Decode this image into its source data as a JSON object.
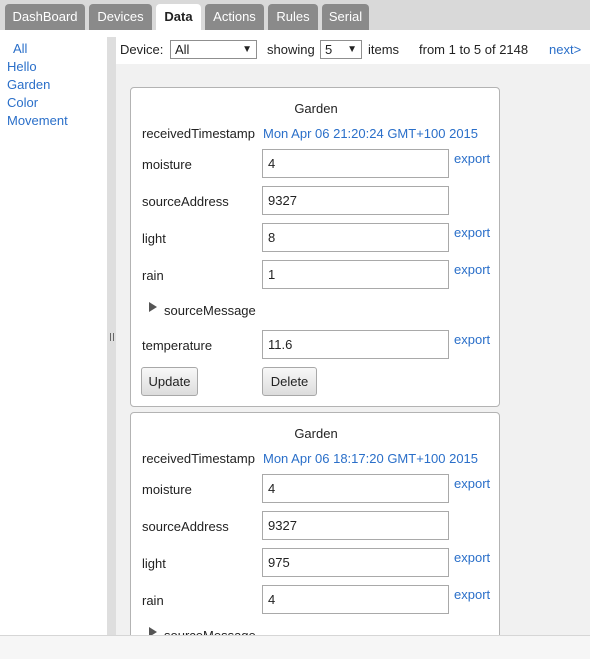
{
  "tabs": [
    {
      "label": "DashBoard"
    },
    {
      "label": "Devices"
    },
    {
      "label": "Data",
      "active": true
    },
    {
      "label": "Actions"
    },
    {
      "label": "Rules"
    },
    {
      "label": "Serial"
    }
  ],
  "sidebar": {
    "items": [
      {
        "label": "All"
      },
      {
        "label": "Hello"
      },
      {
        "label": "Garden"
      },
      {
        "label": "Color"
      },
      {
        "label": "Movement"
      }
    ]
  },
  "toolbar": {
    "device_label": "Device:",
    "device_value": "All",
    "showing_label": "showing",
    "count_value": "5",
    "items_label": "items",
    "range_text": "from 1 to 5 of 2148",
    "next_label": "next>"
  },
  "cards": [
    {
      "title": "Garden",
      "received_label": "receivedTimestamp",
      "received_value": "Mon Apr 06 21:20:24 GMT+100 2015",
      "moisture_label": "moisture",
      "moisture_value": "4",
      "source_label": "sourceAddress",
      "source_value": "9327",
      "light_label": "light",
      "light_value": "8",
      "rain_label": "rain",
      "rain_value": "1",
      "message_label": "sourceMessage",
      "temperature_label": "temperature",
      "temperature_value": "11.6",
      "export_label": "export",
      "update_label": "Update",
      "delete_label": "Delete"
    },
    {
      "title": "Garden",
      "received_label": "receivedTimestamp",
      "received_value": "Mon Apr 06 18:17:20 GMT+100 2015",
      "moisture_label": "moisture",
      "moisture_value": "4",
      "source_label": "sourceAddress",
      "source_value": "9327",
      "light_label": "light",
      "light_value": "975",
      "rain_label": "rain",
      "rain_value": "4",
      "message_label": "sourceMessage",
      "export_label": "export"
    }
  ],
  "colors": {
    "link": "#2a6fc9",
    "tab_inactive": "#8a8a8a",
    "tab_active": "#ffffff",
    "panel_bg": "#f1f1f1"
  }
}
